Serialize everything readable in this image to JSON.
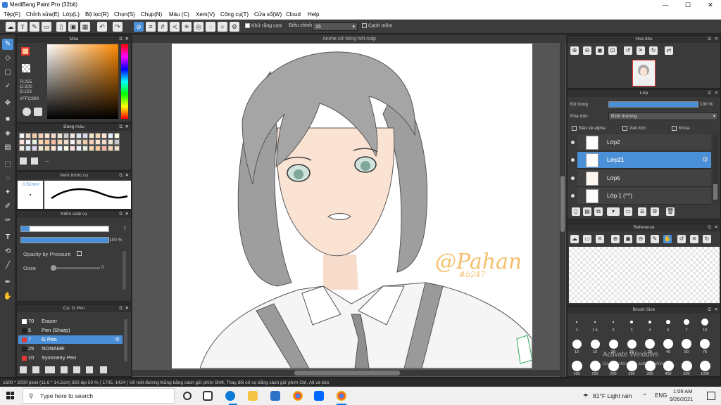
{
  "window": {
    "title": "MediBang Paint Pro (32bit)",
    "min": "—",
    "max": "☐",
    "close": "✕"
  },
  "menu": [
    "Tệp(F)",
    "Chỉnh sửa(E)",
    "Lớp(L)",
    "Bộ lọc(R)",
    "Chọn(S)",
    "Chụp(N)",
    "Màu (C)",
    "Xem(V)",
    "Công cụ(T)",
    "Cửa sổ(W)",
    "Cloud",
    "Help"
  ],
  "toolbar": {
    "antialias_label": "Khử răng cưa",
    "adjust_label": "Điều chỉnh",
    "adjust_value": "15",
    "snap_label": "Cạnh mềm"
  },
  "color_panel": {
    "title": "Màu",
    "r": "R:255",
    "g": "G:200",
    "b": "B:153",
    "hex": "#FFC899",
    "main_color": "#FFC899"
  },
  "palette_panel": {
    "title": "Bảng màu",
    "none_label": "---"
  },
  "brush_preview": {
    "title": "Xem trước cọ",
    "size": "0.51mm"
  },
  "brush_control": {
    "title": "Kiểm soát cọ",
    "size_value": "7",
    "opacity_value": "100 %",
    "pressure_label": "Opacity by Pressure",
    "ooze_label": "Ooze",
    "ooze_value": "0"
  },
  "brush_list": {
    "title": "Cọ: G Pen",
    "items": [
      {
        "num": "70",
        "name": "Eraser",
        "color": "#ffffff"
      },
      {
        "num": "5",
        "name": "Pen (Sharp)",
        "color": "#222222"
      },
      {
        "num": "7",
        "name": "G Pen",
        "color": "#e53935",
        "selected": true
      },
      {
        "num": "25",
        "name": "NONAME",
        "color": "#222222"
      },
      {
        "num": "10",
        "name": "Symmetry Pen",
        "color": "#e53935"
      }
    ]
  },
  "document": {
    "title": "Anime nữ hóng hớt.mdp",
    "signature": "@Pahan",
    "signature_sub": "#b247"
  },
  "navigator": {
    "title": "Hoa tiêu"
  },
  "layer_panel": {
    "title": "Lớp",
    "opacity_label": "Độ trong",
    "opacity_value": "100 %",
    "blend_label": "Pha trộn",
    "blend_value": "Bình thường",
    "protect_alpha": "Bảo vệ alpha",
    "clipping": "Xén bớt",
    "lock": "Khóa",
    "layers": [
      {
        "name": "Lớp2",
        "selected": false
      },
      {
        "name": "Lớp21",
        "selected": true
      },
      {
        "name": "Lớp5",
        "selected": false
      },
      {
        "name": "Lớp 1 (^^)",
        "selected": false
      }
    ]
  },
  "reference": {
    "title": "Reference"
  },
  "brush_size": {
    "title": "Brush Size",
    "sizes": [
      "1",
      "1.5",
      "2",
      "3",
      "4",
      "5",
      "7",
      "10",
      "12",
      "15",
      "20",
      "25",
      "30",
      "40",
      "50",
      "70",
      "100",
      "150",
      "200",
      "250",
      "300",
      "400",
      "500",
      "1000"
    ],
    "watermark": "Activate Windows",
    "watermark_sub": "Go to Settings to activate Windows."
  },
  "status": {
    "text": "1600 * 2000 pixel   (11.6 * 14.5cm)   350 dpi   50 %   ( 1705, 1424 )   Vẽ một đường thẳng bằng cách giữ phím Shift, Thay đổi cỡ cọ bằng cách giữ phím Ctrl, Alt và kéo"
  },
  "taskbar": {
    "search_placeholder": "Type here to search",
    "weather": "81°F  Light rain",
    "lang": "ENG",
    "time": "1:09 AM",
    "date": "9/26/2021"
  }
}
